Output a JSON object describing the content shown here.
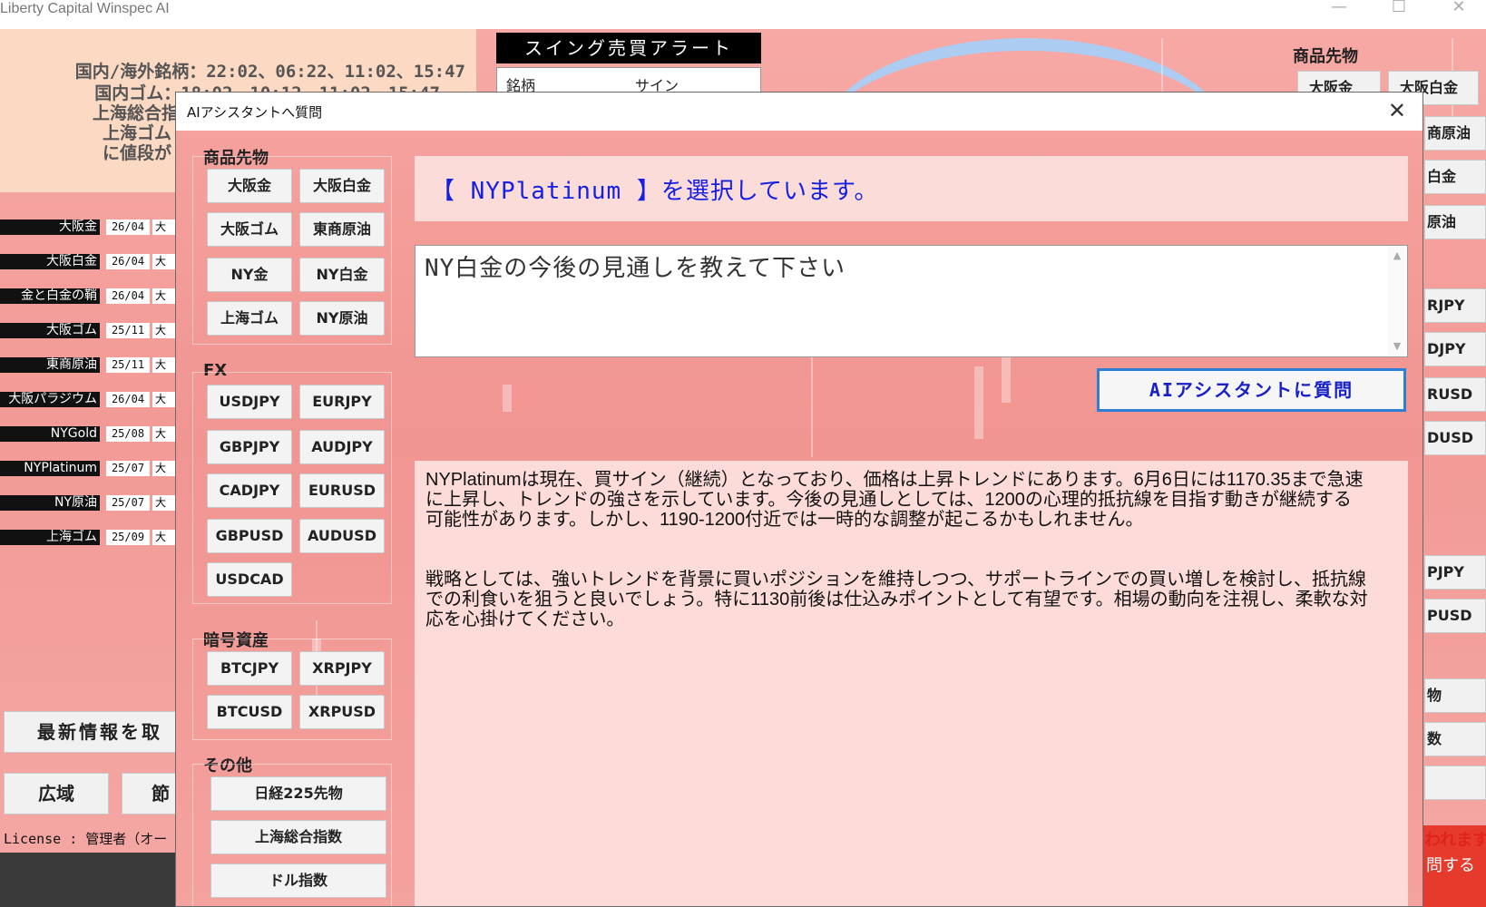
{
  "window": {
    "title": "Liberty Capital Winspec AI",
    "minimize_glyph": "—",
    "maximize_glyph": "☐",
    "close_glyph": "✕"
  },
  "schedule": {
    "line1": "国内/海外銘柄：22:02、06:22、11:02、15:47",
    "line2": "国内ゴム：18:02、10:12、11:02、15:47",
    "line3": "上海総合指",
    "line4": "上海ゴム",
    "line5": "に値段が"
  },
  "alert": {
    "title": "スイング売買アラート",
    "col_symbol": "銘柄",
    "col_sign": "サイン"
  },
  "quotes": [
    {
      "name": "大阪金",
      "date": "26/04",
      "extra": "大"
    },
    {
      "name": "大阪白金",
      "date": "26/04",
      "extra": "大"
    },
    {
      "name": "金と白金の鞘",
      "date": "26/04",
      "extra": "大"
    },
    {
      "name": "大阪ゴム",
      "date": "25/11",
      "extra": "大"
    },
    {
      "name": "東商原油",
      "date": "25/11",
      "extra": "大"
    },
    {
      "name": "大阪パラジウム",
      "date": "26/04",
      "extra": "大"
    },
    {
      "name": "NYGold",
      "date": "25/08",
      "extra": "大"
    },
    {
      "name": "NYPlatinum",
      "date": "25/07",
      "extra": "大"
    },
    {
      "name": "NY原油",
      "date": "25/07",
      "extra": "大"
    },
    {
      "name": "上海ゴム",
      "date": "25/09",
      "extra": "大"
    }
  ],
  "left_buttons": {
    "latest": "最新情報を取",
    "wide": "広域",
    "node": "節"
  },
  "license": "License : 管理者（オー",
  "right_panel": {
    "label": "商品先物",
    "buttons": [
      "大阪金",
      "大阪白金",
      "商原油",
      "白金",
      "原油",
      "RJPY",
      "DJPY",
      "RUSD",
      "DUSD",
      "PJPY",
      "PUSD",
      "物",
      "数"
    ],
    "note1": "われます",
    "note2": "問する"
  },
  "dialog": {
    "title": "AIアシスタントへ質問",
    "close_glyph": "✕",
    "categories": {
      "commodities": {
        "label": "商品先物",
        "buttons": [
          "大阪金",
          "大阪白金",
          "大阪ゴム",
          "東商原油",
          "NY金",
          "NY白金",
          "上海ゴム",
          "NY原油"
        ]
      },
      "fx": {
        "label": "FX",
        "buttons": [
          "USDJPY",
          "EURJPY",
          "GBPJPY",
          "AUDJPY",
          "CADJPY",
          "EURUSD",
          "GBPUSD",
          "AUDUSD",
          "USDCAD"
        ]
      },
      "crypto": {
        "label": "暗号資産",
        "buttons": [
          "BTCJPY",
          "XRPJPY",
          "BTCUSD",
          "XRPUSD"
        ]
      },
      "other": {
        "label": "その他",
        "buttons": [
          "日経225先物",
          "上海総合指数",
          "ドル指数"
        ]
      }
    },
    "selection_text": "【 NYPlatinum 】を選択しています。",
    "question_value": "NY白金の今後の見通しを教えて下さい",
    "ask_button": "AIアシスタントに質問",
    "answer": {
      "p1": "NYPlatinumは現在、買サイン（継続）となっており、価格は上昇トレンドにあります。6月6日には1170.35まで急速に上昇し、トレンドの強さを示しています。今後の見通しとしては、1200の心理的抵抗線を目指す動きが継続する可能性があります。しかし、1190-1200付近では一時的な調整が起こるかもしれません。",
      "p2": "戦略としては、強いトレンドを背景に買いポジションを維持しつつ、サポートラインでの買い増しを検討し、抵抗線での利食いを狙うと良いでしょう。特に1130前後は仕込みポイントとして有望です。相場の動向を注視し、柔軟な対応を心掛けてください。"
    }
  }
}
